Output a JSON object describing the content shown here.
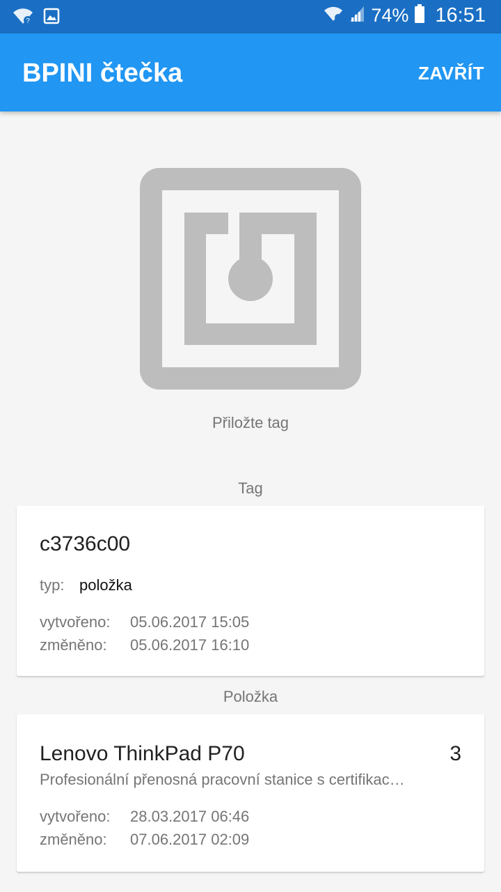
{
  "status_bar": {
    "battery_percent": "74%",
    "time": "16:51",
    "icons": [
      "wifi-call-icon",
      "image-icon",
      "wifi-icon",
      "signal-icon",
      "battery-icon"
    ]
  },
  "app_bar": {
    "title": "BPINI čtečka",
    "close_label": "ZAVŘÍT",
    "color": "#2196f3"
  },
  "nfc": {
    "icon": "nfc-tag-icon",
    "prompt": "Přiložte tag"
  },
  "tag_section": {
    "heading": "Tag",
    "id": "c3736c00",
    "type_label": "typ:",
    "type_value": "položka",
    "created_label": "vytvořeno:",
    "created_value": "05.06.2017 15:05",
    "modified_label": "změněno:",
    "modified_value": "05.06.2017 16:10"
  },
  "item_section": {
    "heading": "Položka",
    "name": "Lenovo ThinkPad P70",
    "count": "3",
    "description": "Profesionální přenosná pracovní stanice s certifikac…",
    "created_label": "vytvořeno:",
    "created_value": "28.03.2017 06:46",
    "modified_label": "změněno:",
    "modified_value": "07.06.2017 02:09"
  }
}
